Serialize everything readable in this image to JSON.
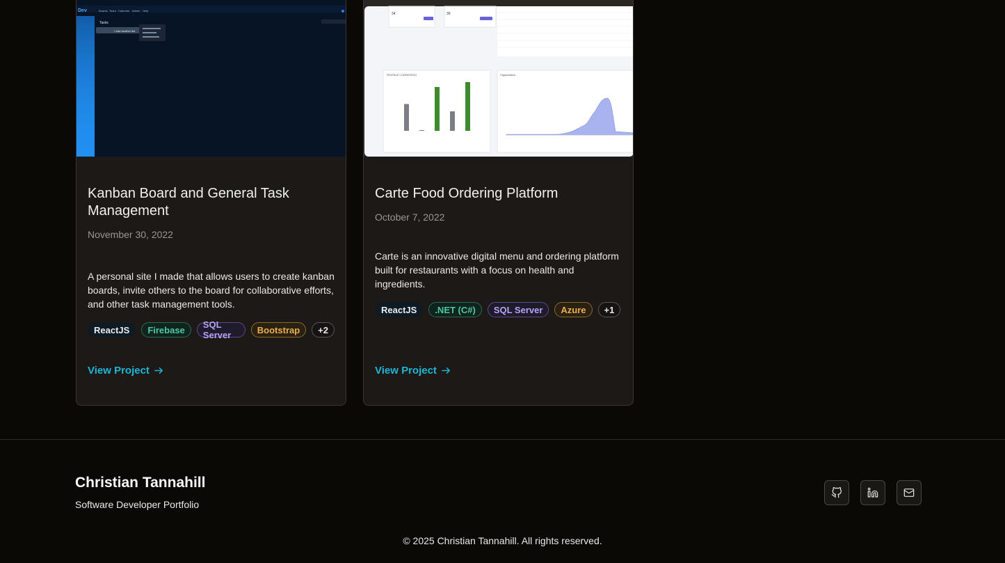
{
  "projects": [
    {
      "title": "Kanban Board and General Task Management",
      "date": "November 30, 2022",
      "description": "A personal site I made that allows users to create kanban boards, invite others to the board for collaborative efforts, and other task management tools.",
      "tags": [
        "ReactJS",
        "Firebase",
        "SQL Server",
        "Bootstrap",
        "+2"
      ],
      "link_label": "View Project",
      "screenshot": {
        "menu": [
          "Boards",
          "Team",
          "Calendar",
          "Admin",
          "Help"
        ],
        "add_list": "+ Add another list",
        "tasks_label": "Tasks"
      }
    },
    {
      "title": "Carte Food Ordering Platform",
      "date": "October 7, 2022",
      "description": "Carte is an innovative digital menu and ordering platform built for restaurants with a focus on health and ingredients.",
      "tags": [
        "ReactJS",
        ".NET (C#)",
        "SQL Server",
        "Azure",
        "+1"
      ],
      "link_label": "View Project",
      "screenshot": {
        "stat1": "34",
        "stat2": "39",
        "chart1_title": "REVENUE COMPARISON",
        "chart2_title": "Organizations",
        "bars": [
          0.55,
          0.0,
          0.9,
          0.4,
          1.0
        ]
      }
    }
  ],
  "footer": {
    "name": "Christian Tannahill",
    "subtitle": "Software Developer Portfolio",
    "copyright": "© 2025 Christian Tannahill. All rights reserved.",
    "socials": [
      "github-icon",
      "linkedin-icon",
      "mail-icon"
    ]
  },
  "colors": {
    "background": "#0b0906",
    "card": "#1c1916",
    "accent": "#1fb6d8"
  }
}
